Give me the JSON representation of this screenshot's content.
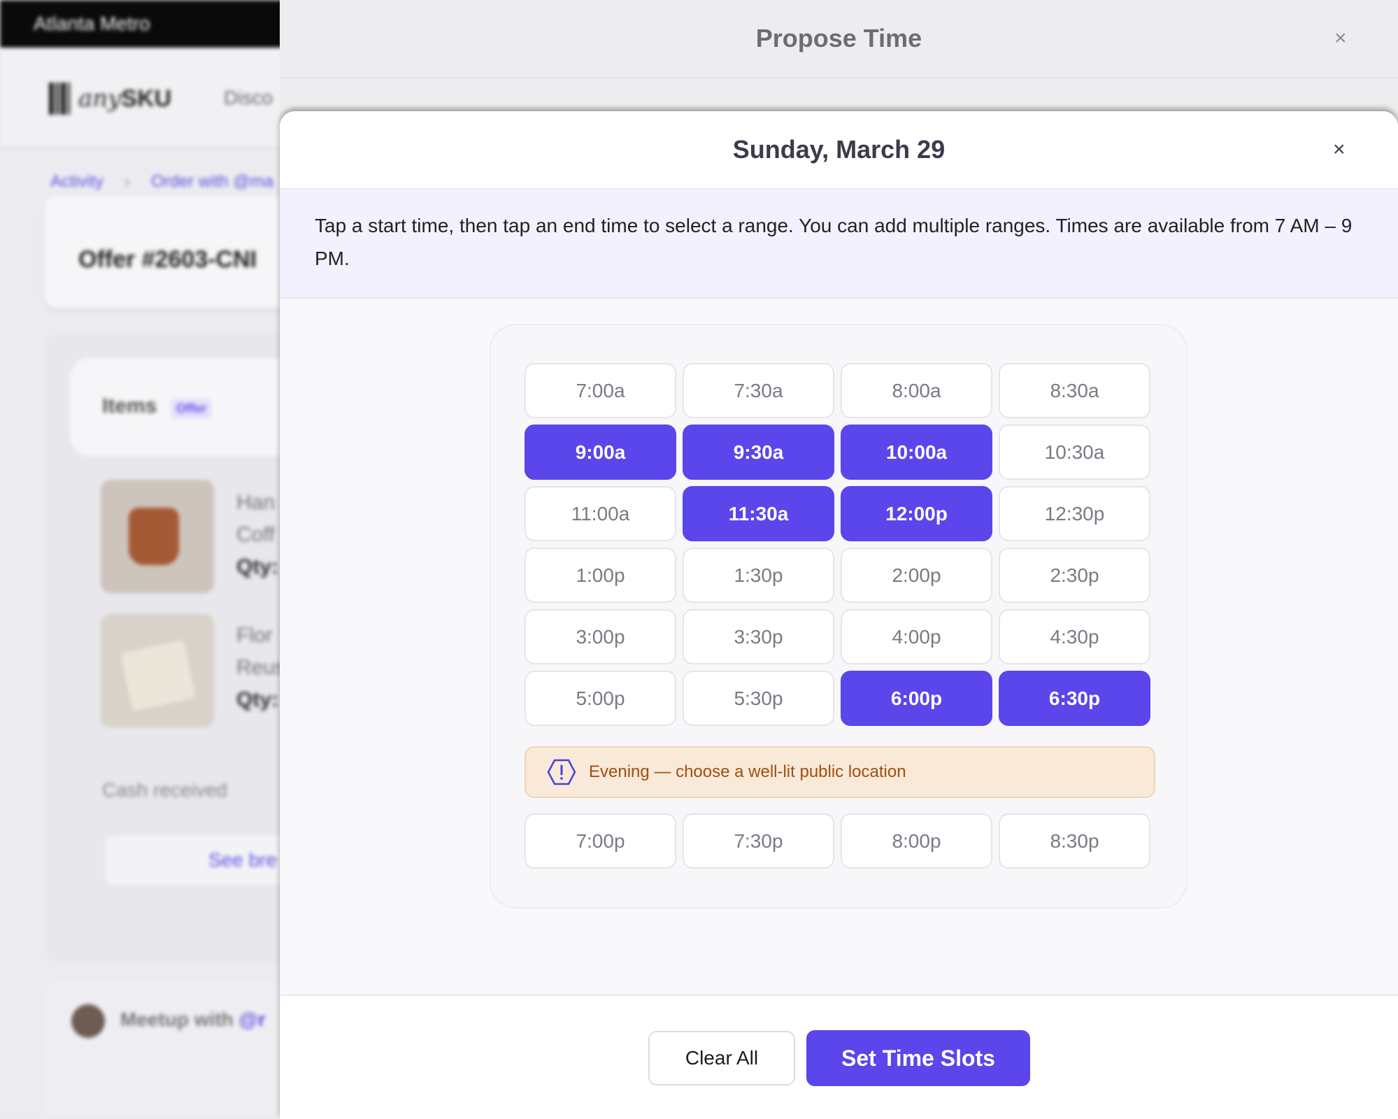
{
  "background": {
    "region": "Atlanta Metro",
    "logo": {
      "any": "any",
      "sku": "SKU"
    },
    "nav_link": "Disco",
    "breadcrumb": [
      "Activity",
      "Order with @ma"
    ],
    "offer_title": "Offer #2603-CNI",
    "items_label": "Items",
    "items_badge": "Offer",
    "items": [
      {
        "line1": "Han",
        "line2": "Coff",
        "qty": "Qty:"
      },
      {
        "line1": "Flor",
        "line2": "Reus",
        "qty": "Qty:"
      }
    ],
    "cash_received": "Cash received",
    "see_button": "See bre",
    "meetup_prefix": "Meetup with",
    "meetup_handle": "@r"
  },
  "outer_modal": {
    "title": "Propose Time",
    "close": "×"
  },
  "sheet": {
    "title": "Sunday, March 29",
    "close": "×",
    "instructions": "Tap a start time, then tap an end time to select a range. You can add multiple ranges. Times are available from 7 AM – 9 PM.",
    "slots": [
      {
        "label": "7:00a",
        "selected": false
      },
      {
        "label": "7:30a",
        "selected": false
      },
      {
        "label": "8:00a",
        "selected": false
      },
      {
        "label": "8:30a",
        "selected": false
      },
      {
        "label": "9:00a",
        "selected": true
      },
      {
        "label": "9:30a",
        "selected": true
      },
      {
        "label": "10:00a",
        "selected": true
      },
      {
        "label": "10:30a",
        "selected": false
      },
      {
        "label": "11:00a",
        "selected": false
      },
      {
        "label": "11:30a",
        "selected": true
      },
      {
        "label": "12:00p",
        "selected": true
      },
      {
        "label": "12:30p",
        "selected": false
      },
      {
        "label": "1:00p",
        "selected": false
      },
      {
        "label": "1:30p",
        "selected": false
      },
      {
        "label": "2:00p",
        "selected": false
      },
      {
        "label": "2:30p",
        "selected": false
      },
      {
        "label": "3:00p",
        "selected": false
      },
      {
        "label": "3:30p",
        "selected": false
      },
      {
        "label": "4:00p",
        "selected": false
      },
      {
        "label": "4:30p",
        "selected": false
      },
      {
        "label": "5:00p",
        "selected": false
      },
      {
        "label": "5:30p",
        "selected": false
      },
      {
        "label": "6:00p",
        "selected": true
      },
      {
        "label": "6:30p",
        "selected": true
      }
    ],
    "warning": "Evening — choose a well-lit public location",
    "evening_slots": [
      {
        "label": "7:00p",
        "selected": false
      },
      {
        "label": "7:30p",
        "selected": false
      },
      {
        "label": "8:00p",
        "selected": false
      },
      {
        "label": "8:30p",
        "selected": false
      }
    ],
    "buttons": {
      "clear": "Clear All",
      "set": "Set Time Slots"
    }
  },
  "colors": {
    "accent": "#5a46ea",
    "warning_bg": "#f9e9d8",
    "warning_text": "#a14e10",
    "info_bg": "#f3f1fd"
  },
  "icons": {
    "warning": "warning-hexagon-icon",
    "close": "close-icon",
    "breadcrumb_separator": "chevron-right-icon"
  }
}
